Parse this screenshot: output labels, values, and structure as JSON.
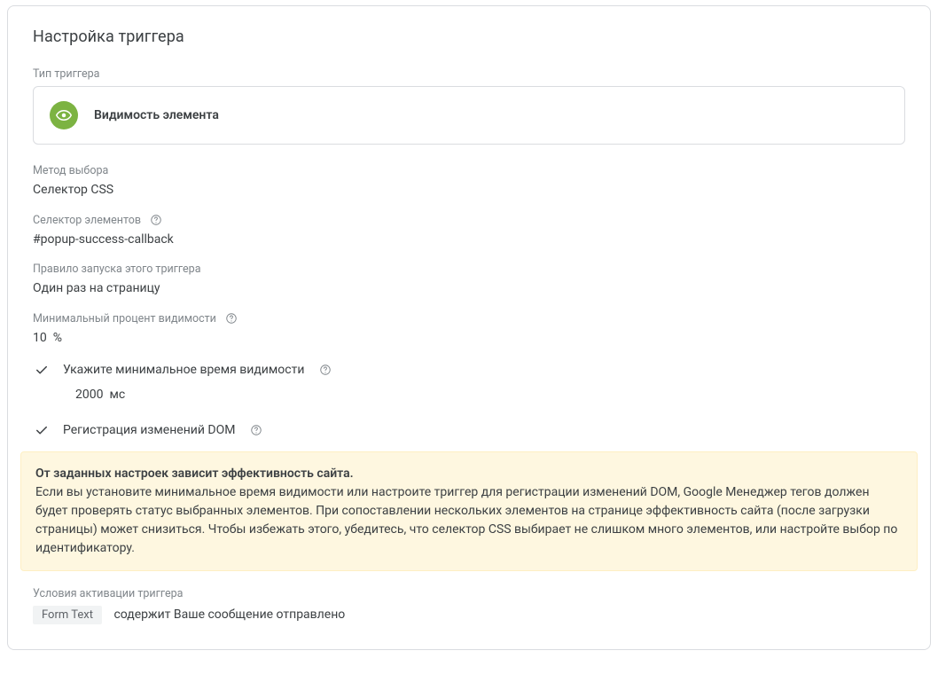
{
  "title": "Настройка триггера",
  "trigger_type": {
    "label": "Тип триггера",
    "name": "Видимость элемента"
  },
  "selection_method": {
    "label": "Метод выбора",
    "value": "Селектор CSS"
  },
  "element_selector": {
    "label": "Селектор элементов",
    "value": "#popup-success-callback"
  },
  "fire_rule": {
    "label": "Правило запуска этого триггера",
    "value": "Один раз на страницу"
  },
  "min_percent": {
    "label": "Минимальный процент видимости",
    "value": "10",
    "unit": "%"
  },
  "min_time": {
    "label": "Укажите минимальное время видимости",
    "value": "2000",
    "unit": "мс"
  },
  "dom_observe": {
    "label": "Регистрация изменений DOM"
  },
  "warning": {
    "title": "От заданных настроек зависит эффективность сайта.",
    "body": "Если вы установите минимальное время видимости или настроите триггер для регистрации изменений DOM, Google Менеджер тегов должен будет проверять статус выбранных элементов. При сопоставлении нескольких элементов на странице эффективность сайта (после загрузки страницы) может снизиться. Чтобы избежать этого, убедитесь, что селектор CSS выбирает не слишком много элементов, или настройте выбор по идентификатору."
  },
  "activation": {
    "label": "Условия активации триггера",
    "variable": "Form Text",
    "condition": "содержит Ваше сообщение отправлено"
  }
}
